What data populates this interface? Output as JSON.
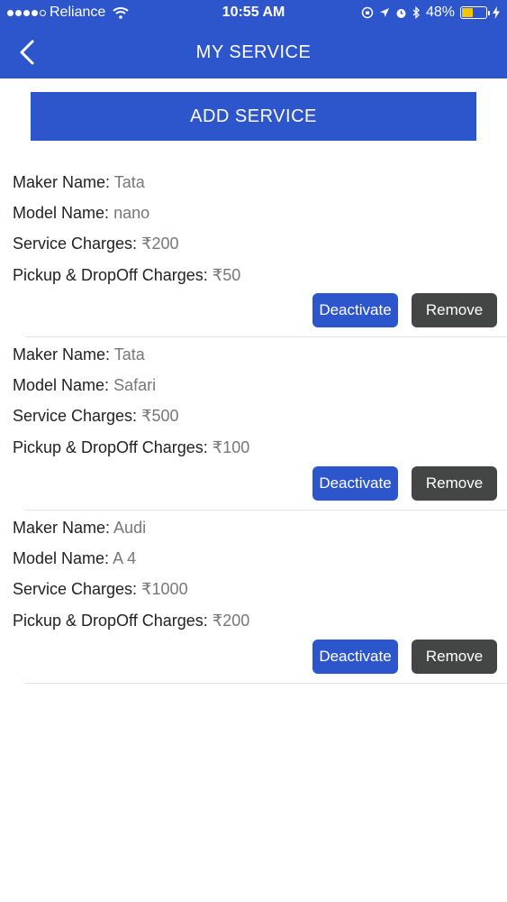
{
  "status_bar": {
    "carrier": "Reliance",
    "time": "10:55 AM",
    "battery_percent": "48%",
    "battery_level": 0.48,
    "icons": [
      "signal-dots-icon",
      "wifi-icon",
      "orientation-lock-icon",
      "location-arrow-icon",
      "alarm-icon",
      "bluetooth-icon",
      "battery-icon",
      "charging-bolt-icon"
    ]
  },
  "nav": {
    "title": "MY SERVICE",
    "back_icon": "chevron-left-icon"
  },
  "add_service_label": "ADD SERVICE",
  "labels": {
    "maker": "Maker Name:",
    "model": "Model Name:",
    "service": "Service Charges:",
    "pickup": "Pickup & DropOff Charges:"
  },
  "services": [
    {
      "maker": "Tata",
      "model": "nano",
      "service_charges": "₹200",
      "pickup_charges": "₹50",
      "deactivate_label": "Deactivate",
      "remove_label": "Remove"
    },
    {
      "maker": "Tata",
      "model": "Safari",
      "service_charges": "₹500",
      "pickup_charges": "₹100",
      "deactivate_label": "Deactivate",
      "remove_label": "Remove"
    },
    {
      "maker": "Audi",
      "model": "A 4",
      "service_charges": "₹1000",
      "pickup_charges": "₹200",
      "deactivate_label": "Deactivate",
      "remove_label": "Remove"
    }
  ],
  "colors": {
    "primary": "#2d55cc",
    "remove_button": "#444646",
    "value_text": "#777777",
    "battery_fill": "#f6c400"
  }
}
